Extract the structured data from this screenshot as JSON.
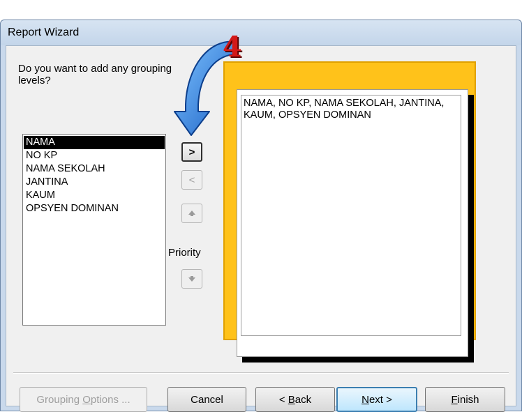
{
  "window": {
    "title": "Report Wizard"
  },
  "prompt": {
    "question": "Do you want to add any grouping levels?"
  },
  "fields": {
    "items": [
      {
        "label": "NAMA",
        "selected": true
      },
      {
        "label": "NO KP",
        "selected": false
      },
      {
        "label": "NAMA SEKOLAH",
        "selected": false
      },
      {
        "label": "JANTINA",
        "selected": false
      },
      {
        "label": "KAUM",
        "selected": false
      },
      {
        "label": "OPSYEN DOMINAN",
        "selected": false
      }
    ]
  },
  "move_buttons": {
    "add": {
      "label": ">",
      "enabled": true
    },
    "remove": {
      "label": "<",
      "enabled": false
    },
    "priority_up": {
      "icon": "arrow-up-icon",
      "enabled": false
    },
    "priority_down": {
      "icon": "arrow-down-icon",
      "enabled": false
    },
    "priority_label": "Priority"
  },
  "preview": {
    "text": "NAMA, NO KP, NAMA SEKOLAH, JANTINA, KAUM, OPSYEN DOMINAN"
  },
  "annotation": {
    "step_number": "4",
    "arrow_color": "#1f6fd1",
    "number_color": "#d31818"
  },
  "buttons": {
    "grouping_options": {
      "pre": "Grouping ",
      "key": "O",
      "post": "ptions ...",
      "enabled": false
    },
    "cancel": {
      "label": "Cancel",
      "enabled": true
    },
    "back": {
      "pre": "< ",
      "key": "B",
      "post": "ack",
      "enabled": true
    },
    "next": {
      "pre": "",
      "key": "N",
      "post": "ext >",
      "enabled": true,
      "default": true
    },
    "finish": {
      "pre": "",
      "key": "F",
      "post": "inish",
      "enabled": true
    }
  },
  "colors": {
    "frame": "#ffc21a",
    "selection": "#000000"
  }
}
